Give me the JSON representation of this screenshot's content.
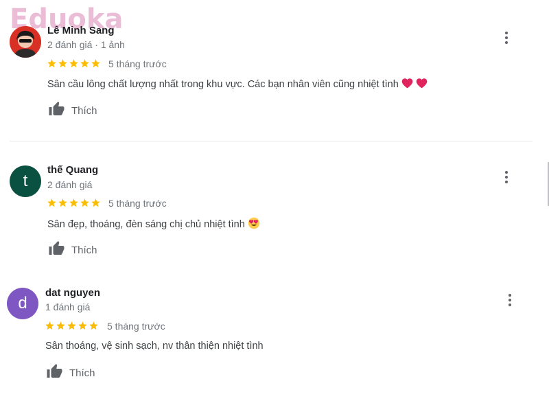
{
  "watermark": "Eduoka",
  "reviews": [
    {
      "author": "Lê Minh Sang",
      "meta": "2 đánh giá · 1 ảnh",
      "rating": 5,
      "date": "5 tháng trước",
      "text": "Sân cầu lông chất lượng nhất trong khu vực. Các bạn nhân viên cũng nhiệt tình",
      "emoji": [
        "heart-emoji",
        "heart-emoji"
      ],
      "like_label": "Thích",
      "avatar": {
        "type": "photo",
        "color": "#d93025"
      }
    },
    {
      "author": "thế Quang",
      "meta": "2 đánh giá",
      "rating": 5,
      "date": "5 tháng trước",
      "text": "Sân đẹp, thoáng, đèn sáng chị chủ nhiệt tình",
      "emoji": [
        "heart-eyes-emoji"
      ],
      "like_label": "Thích",
      "avatar": {
        "type": "letter",
        "letter": "t",
        "color": "#0b5142"
      }
    },
    {
      "author": "dat nguyen",
      "meta": "1 đánh giá",
      "rating": 5,
      "date": "5 tháng trước",
      "text": "Sân thoáng, vệ sinh sạch, nv thân thiện nhiệt tình",
      "emoji": [],
      "like_label": "Thích",
      "avatar": {
        "type": "letter",
        "letter": "d",
        "color": "#7e57c2"
      }
    }
  ],
  "colors": {
    "star": "#fbbc04",
    "text_secondary": "#70757a",
    "icon": "#5f6368"
  },
  "icons": {
    "like": "thumbs-up-icon",
    "more": "more-vertical-icon",
    "star": "star-icon"
  }
}
